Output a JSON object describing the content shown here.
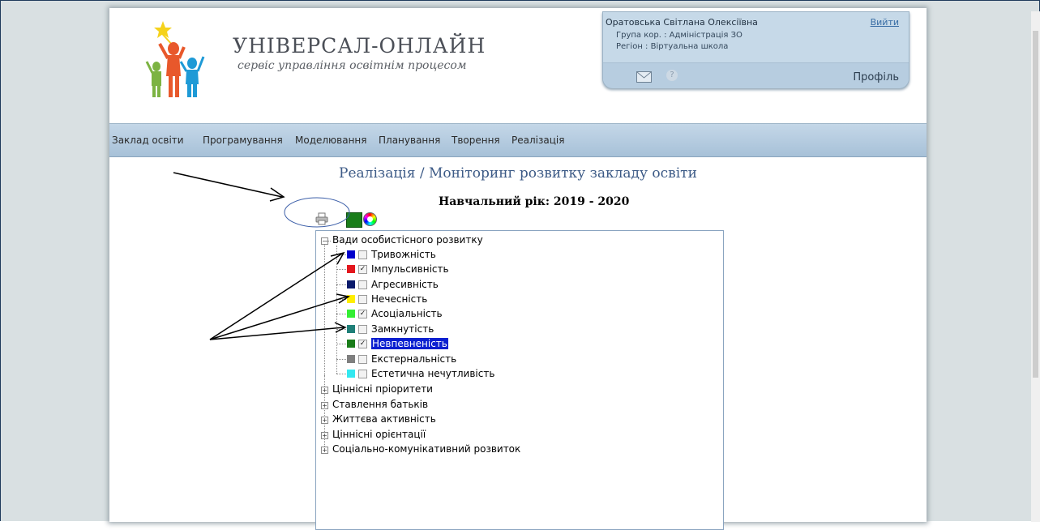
{
  "brand": {
    "title": "УНІВЕРСАЛ-ОНЛАЙН",
    "subtitle": "сервіс управління освітнім процесом"
  },
  "user": {
    "name": "Оратовська Світлана Олексіївна",
    "logout": "Вийти",
    "group": "Група кор. : Адміністрація ЗО",
    "region": "Регіон : Віртуальна школа",
    "help": "?",
    "profile": "Профіль"
  },
  "nav": [
    "Заклад освіти",
    "Програмування",
    "Моделювання",
    "Планування",
    "Творення",
    "Реалізація"
  ],
  "page": {
    "title": "Реалізація / Моніторинг розвитку закладу освіти",
    "year": "Навчальний рік: 2019 - 2020"
  },
  "tree": {
    "root": {
      "label": "Вади особистісного розвитку",
      "glyph": "−"
    },
    "children": [
      {
        "label": "Тривожність",
        "color": "#0000cc",
        "checked": false,
        "check": ""
      },
      {
        "label": "Імпульсивність",
        "color": "#e3161d",
        "checked": true,
        "check": "✓"
      },
      {
        "label": "Агресивність",
        "color": "#0a1a6b",
        "checked": false,
        "check": ""
      },
      {
        "label": "Нечесність",
        "color": "#ffee00",
        "checked": false,
        "check": ""
      },
      {
        "label": "Асоціальність",
        "color": "#33ee33",
        "checked": true,
        "check": "✓"
      },
      {
        "label": "Замкнутість",
        "color": "#1f7f78",
        "checked": false,
        "check": ""
      },
      {
        "label": "Невпевненість",
        "color": "#1a7d1a",
        "checked": true,
        "check": "✓",
        "selected": true
      },
      {
        "label": "Екстернальність",
        "color": "#7f7f7f",
        "checked": false,
        "check": ""
      },
      {
        "label": "Естетична нечутливість",
        "color": "#33e8f0",
        "checked": false,
        "check": ""
      }
    ],
    "collapsed": [
      {
        "label": "Ціннісні пріоритети",
        "glyph": "+"
      },
      {
        "label": "Ставлення батьків",
        "glyph": "+"
      },
      {
        "label": "Життєва активність",
        "glyph": "+"
      },
      {
        "label": "Ціннісні орієнтації",
        "glyph": "+"
      },
      {
        "label": "Соціально-комунікативний розвиток",
        "glyph": "+"
      }
    ]
  },
  "colors": {
    "nav_top": "#c4d7e8",
    "nav_bottom": "#a7c1d8",
    "title": "#3c5a86",
    "selection": "#0a1fd0"
  }
}
